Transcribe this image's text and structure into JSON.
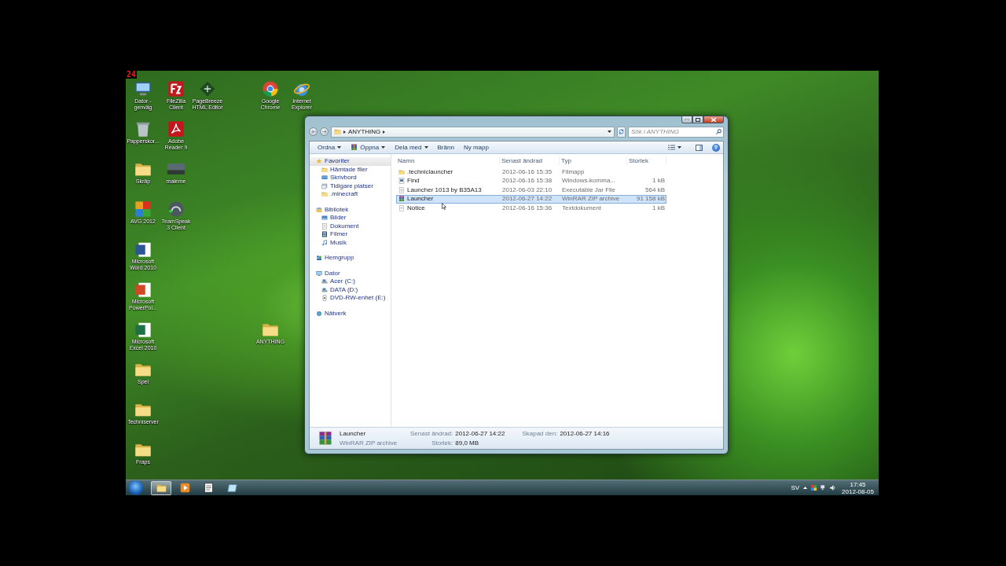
{
  "fps_counter": "24",
  "desktop_icons": [
    {
      "label": "Dator - genväg",
      "kind": "computer"
    },
    {
      "label": "FileZilla Client",
      "kind": "redtile"
    },
    {
      "label": "PageBreeze HTML Editor",
      "kind": "greentile"
    },
    {
      "label": "Google Chrome",
      "kind": "chrome"
    },
    {
      "label": "Internet Explorer",
      "kind": "ie"
    },
    {
      "label": "Papperskor...",
      "kind": "trash"
    },
    {
      "label": "Adobe Reader 9",
      "kind": "pdf"
    },
    {
      "label": "Skräp",
      "kind": "folder"
    },
    {
      "label": "maleme",
      "kind": "photo"
    },
    {
      "label": "AVG 2012",
      "kind": "avg"
    },
    {
      "label": "TeamSpeak 3 Client",
      "kind": "headset"
    },
    {
      "label": "Microsoft Word 2010",
      "kind": "word"
    },
    {
      "label": "Microsoft PowerPoi...",
      "kind": "powerpoint"
    },
    {
      "label": "Microsoft Excel 2010",
      "kind": "excel"
    },
    {
      "label": "ANYTHING",
      "kind": "folder"
    },
    {
      "label": "Spel",
      "kind": "folder"
    },
    {
      "label": "Techniserver",
      "kind": "folder"
    },
    {
      "label": "Fraps",
      "kind": "folder"
    }
  ],
  "explorer": {
    "breadcrumb": [
      "ANYTHING"
    ],
    "search": {
      "placeholder": "Sök i ANYTHING"
    },
    "toolbar": [
      {
        "label": "Ordna",
        "dropdown": true,
        "icon": false
      },
      {
        "label": "Öppna",
        "dropdown": true,
        "icon": true
      },
      {
        "label": "Dela med",
        "dropdown": true,
        "icon": false
      },
      {
        "label": "Bränn",
        "dropdown": false,
        "icon": false
      },
      {
        "label": "Ny mapp",
        "dropdown": false,
        "icon": false
      }
    ],
    "help": "?",
    "nav": [
      {
        "label": "Favoriter",
        "kind": "star",
        "selected": true,
        "children": [
          {
            "label": "Hämtade filer",
            "kind": "folder",
            "selected": false
          },
          {
            "label": "Skrivbord",
            "kind": "desktop",
            "selected": false
          },
          {
            "label": "Tidigare platser",
            "kind": "places",
            "selected": false
          },
          {
            "label": ".minecraft",
            "kind": "folder",
            "selected": false
          }
        ]
      },
      {
        "label": "Bibliotek",
        "kind": "library",
        "selected": false,
        "children": [
          {
            "label": "Bilder",
            "kind": "picture",
            "selected": false
          },
          {
            "label": "Dokument",
            "kind": "docs",
            "selected": false
          },
          {
            "label": "Filmer",
            "kind": "film",
            "selected": false
          },
          {
            "label": "Musik",
            "kind": "music",
            "selected": false
          }
        ]
      },
      {
        "label": "Hemgrupp",
        "kind": "homegroup",
        "selected": false
      },
      {
        "label": "Dator",
        "kind": "computer",
        "selected": false,
        "children": [
          {
            "label": "Acer (C:)",
            "kind": "drive",
            "selected": false
          },
          {
            "label": "DATA (D:)",
            "kind": "drive",
            "selected": false
          },
          {
            "label": "DVD-RW-enhet (E:)",
            "kind": "dvd",
            "selected": false
          }
        ]
      },
      {
        "label": "Nätverk",
        "kind": "network",
        "selected": false
      }
    ],
    "columns": [
      "Namn",
      "Senast ändrad",
      "Typ",
      "Storlek"
    ],
    "rows": [
      {
        "name": ".techniclauncher",
        "kind": "folder",
        "modified": "2012-06-16 15:35",
        "type": "Filmapp",
        "selected": false
      },
      {
        "name": "Find",
        "kind": "cmd",
        "modified": "2012-06-16 15:38",
        "type": "Windows-komma...",
        "size": "1 kB",
        "selected": false
      },
      {
        "name": "Launcher 1013 by B35A13",
        "kind": "jar",
        "modified": "2012-06-03 22:10",
        "type": "Executable Jar File",
        "size": "564 kB",
        "selected": false
      },
      {
        "name": "Launcher",
        "kind": "archive",
        "modified": "2012-06-27 14:22",
        "type": "WinRAR ZIP archive",
        "size": "91 158 kB",
        "selected": true
      },
      {
        "name": "Notice",
        "kind": "text",
        "modified": "2012-06-16 15:36",
        "type": "Textdokument",
        "size": "1 kB",
        "selected": false
      }
    ],
    "details": {
      "name": "Launcher",
      "type": "WinRAR ZIP archive",
      "kind": "archive",
      "fields": [
        {
          "label": "Senast ändrad:",
          "value": "2012-06-27 14:22"
        },
        {
          "label": "Storlek:",
          "value": "89,0 MB"
        },
        {
          "label": "Skapad den:",
          "value": "2012-06-27 14:16"
        }
      ]
    }
  },
  "taskbar": {
    "buttons": [
      {
        "kind": "folder",
        "active": true
      },
      {
        "kind": "media",
        "active": false
      },
      {
        "kind": "document",
        "active": false
      },
      {
        "kind": "window",
        "active": false
      }
    ],
    "language": "SV",
    "time": "17:45",
    "date": "2012-08-05"
  }
}
